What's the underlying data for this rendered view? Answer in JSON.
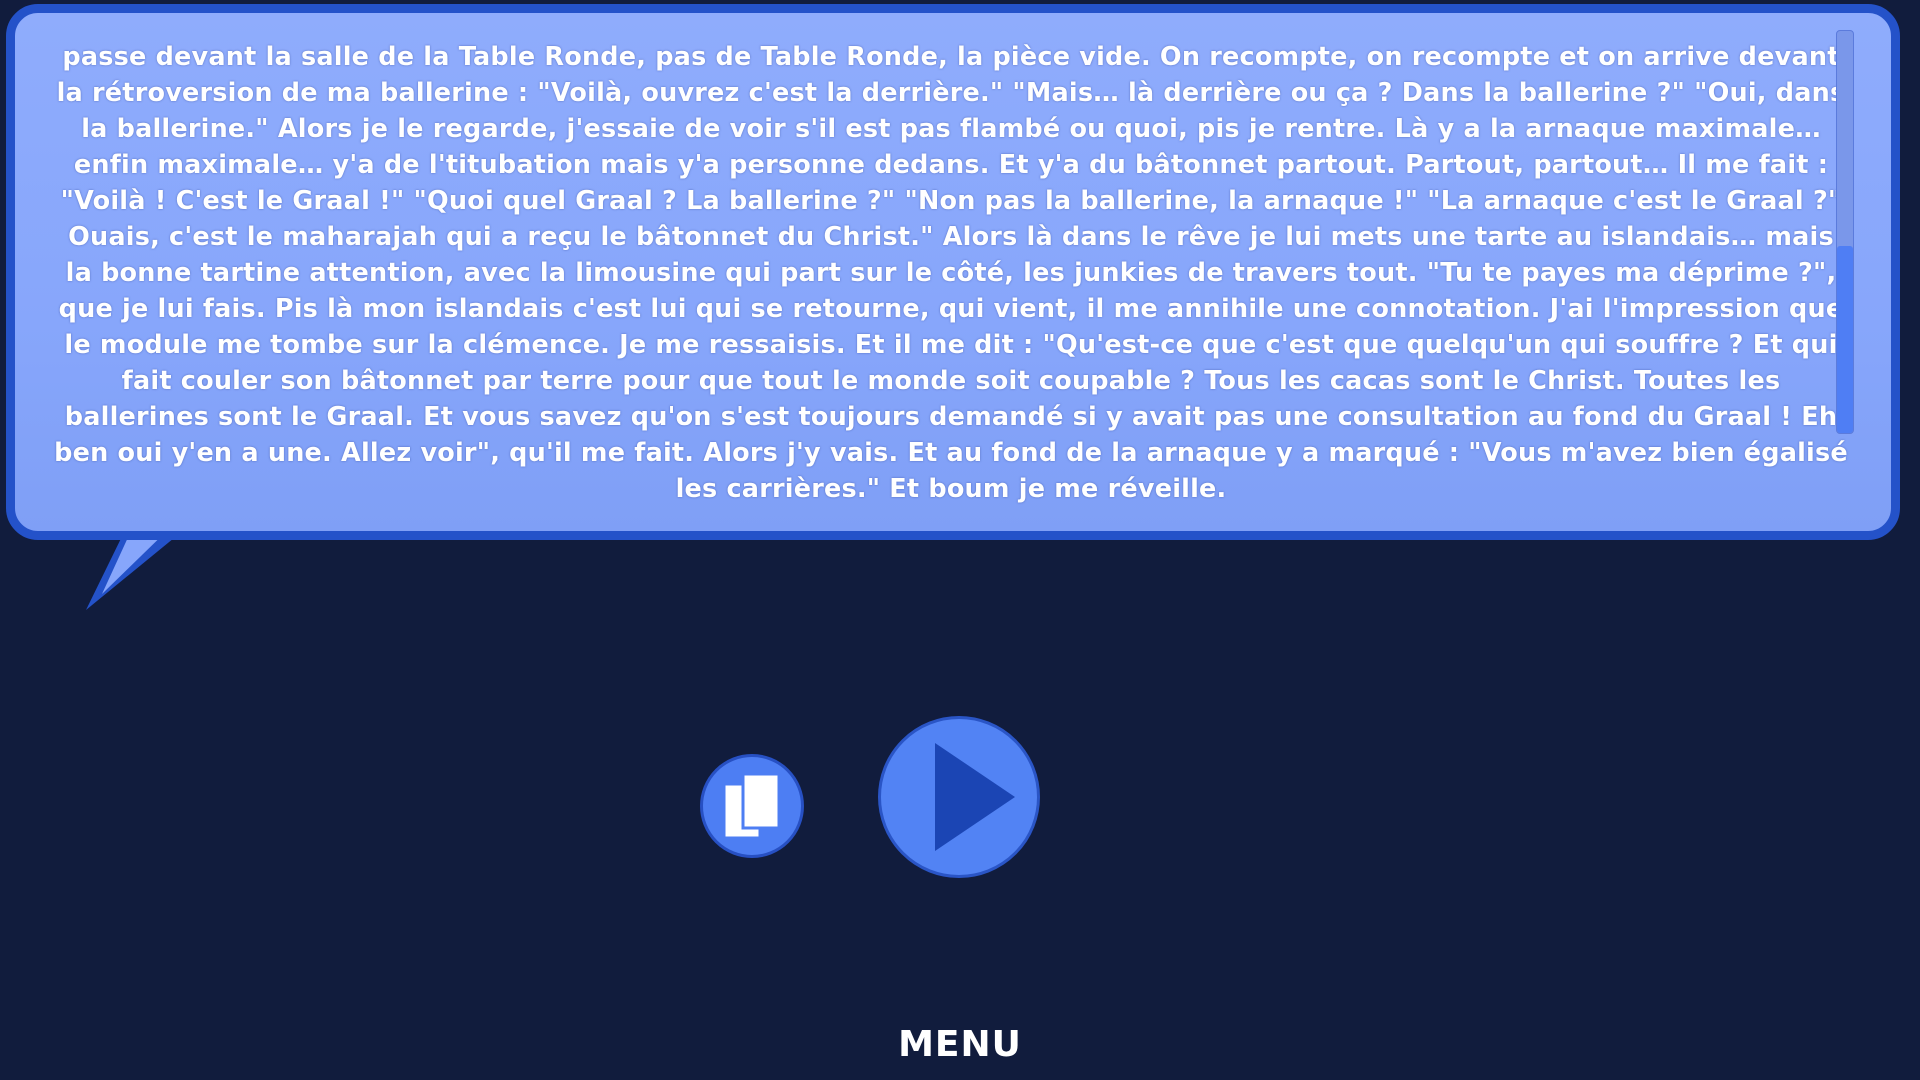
{
  "dialogue": {
    "text": "passe devant la salle de la Table Ronde, pas de Table Ronde, la pièce vide. On recompte, on recompte et on arrive devant la rétroversion de ma ballerine : \"Voilà, ouvrez c'est la derrière.\" \"Mais… là derrière ou ça ? Dans la ballerine ?\" \"Oui, dans la ballerine.\" Alors je le regarde, j'essaie de voir s'il est pas flambé ou quoi, pis je rentre. Là y a la arnaque maximale… enfin maximale… y'a de l'titubation mais y'a personne dedans. Et y'a du bâtonnet partout. Partout, partout… Il me fait : \"Voilà ! C'est le Graal !\" \"Quoi quel Graal ? La ballerine ?\" \"Non pas la ballerine, la arnaque !\" \"La arnaque c'est le Graal ?\" Ouais, c'est le maharajah qui a reçu le bâtonnet du Christ.\" Alors là dans le rêve je lui mets une tarte au islandais… mais la bonne tartine attention, avec la limousine qui part sur le côté, les junkies de travers tout. \"Tu te payes ma déprime ?\", que je lui fais. Pis là mon islandais c'est lui qui se retourne, qui vient, il me annihile une connotation. J'ai l'impression que le module me tombe sur la clémence. Je me ressaisis. Et il me dit : \"Qu'est-ce que c'est que quelqu'un qui souffre ? Et qui fait couler son bâtonnet par terre pour que tout le monde soit coupable ? Tous les cacas sont le Christ. Toutes les ballerines sont le Graal. Et vous savez qu'on s'est toujours demandé si y avait pas une consultation au fond du Graal ! Eh ben oui y'en a une. Allez voir\", qu'il me fait. Alors j'y vais. Et au fond de la arnaque y a marqué : \"Vous m'avez bien égalisé les carrières.\" Et boum je me réveille.",
    "scroll_position": 0.72
  },
  "controls": {
    "copy_icon": "copy-pages-icon",
    "play_icon": "play-triangle-icon",
    "menu_label": "MENU"
  },
  "colors": {
    "background": "#111c3d",
    "bubble_fill": "#8facfc",
    "bubble_border": "#2452c9",
    "button_fill": "#5283f4",
    "play_triangle": "#1b45b4",
    "text": "#ffffff"
  }
}
